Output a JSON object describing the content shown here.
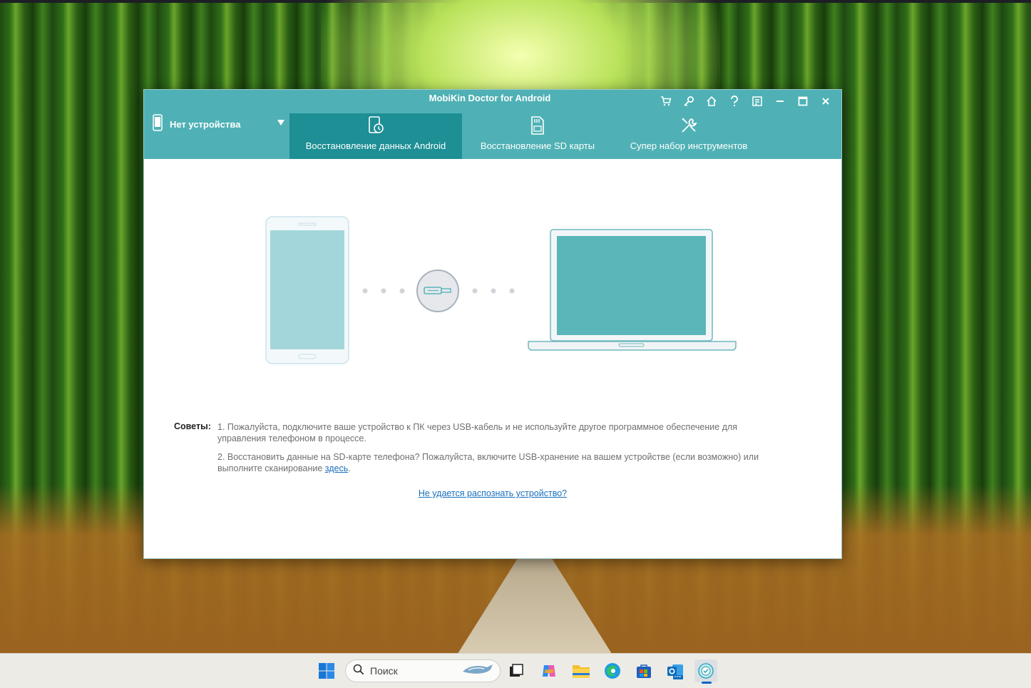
{
  "window": {
    "title": "MobiKin Doctor for Android",
    "device_label": "Нет устройства",
    "controls": [
      "cart-icon",
      "key-icon",
      "home-icon",
      "help-icon",
      "feedback-icon",
      "minimize-icon",
      "maximize-icon",
      "close-icon"
    ]
  },
  "tabs": [
    {
      "label": "Восстановление данных Android",
      "icon": "restore-phone-icon",
      "active": true
    },
    {
      "label": "Восстановление SD карты",
      "icon": "sd-card-icon",
      "active": false
    },
    {
      "label": "Супер набор инструментов",
      "icon": "tools-icon",
      "active": false
    }
  ],
  "tips": {
    "label": "Советы:",
    "tip1": "1. Пожалуйста, подключите ваше устройство к ПК через USB-кабель и не используйте другое программное обеспечение для управления телефоном в процессе.",
    "tip2_text": "2. Восстановить данные на SD-карте телефона? Пожалуйста, включите USB-хранение на вашем устройстве (если возможно) или выполните сканирование ",
    "tip2_link": "здесь",
    "tip2_end": "."
  },
  "help_link": "Не удается распознать устройство?",
  "taskbar": {
    "search_placeholder": "Поиск",
    "apps": [
      "windows-start-icon",
      "task-view-icon",
      "copilot-icon",
      "file-explorer-icon",
      "edge-icon",
      "store-icon",
      "outlook-icon",
      "mobikin-app-icon"
    ]
  },
  "colors": {
    "header": "#4fb1b5",
    "active_tab": "#1d8f95",
    "illustration_fill": "#5ab6b8",
    "link": "#1a6fbe"
  }
}
